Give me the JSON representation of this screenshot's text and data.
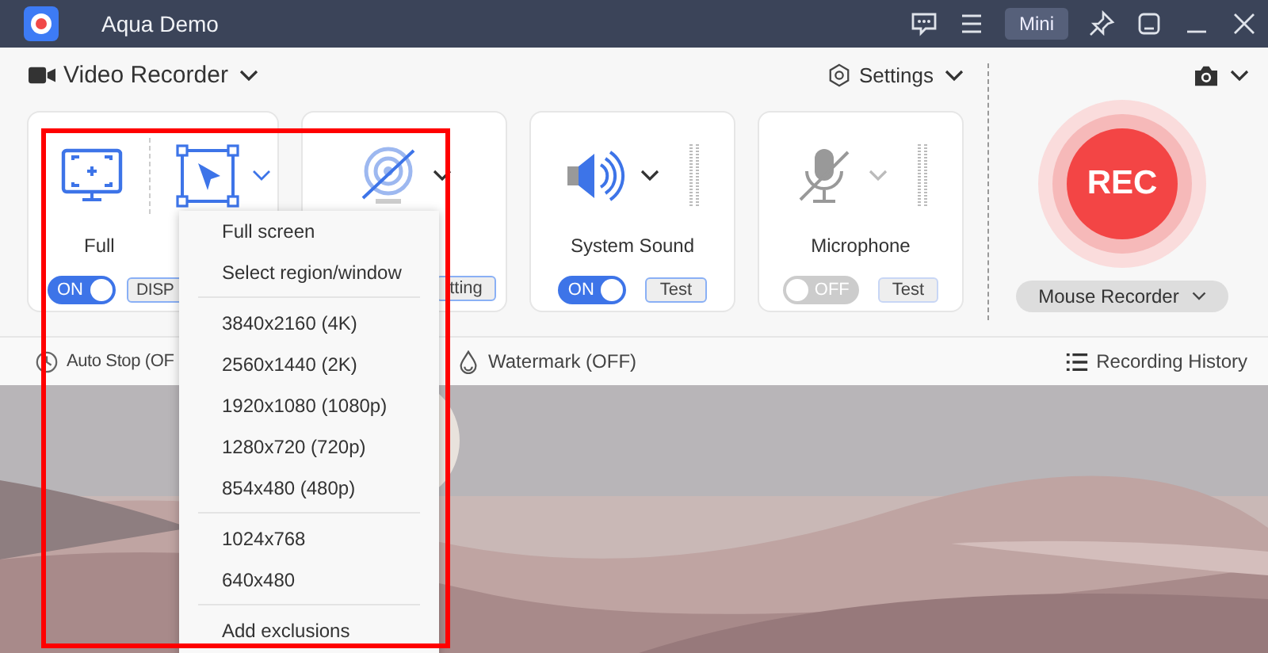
{
  "window": {
    "title": "Aqua Demo",
    "mini_button": "Mini"
  },
  "toolbar": {
    "mode": "Video Recorder",
    "settings": "Settings"
  },
  "cards": [
    {
      "kind": "display",
      "label": "Full",
      "toggle": {
        "label": "ON",
        "on": true
      },
      "button": "DISP"
    },
    {
      "kind": "webcam",
      "button": "tting"
    },
    {
      "kind": "sound",
      "label": "System Sound",
      "toggle": {
        "label": "ON",
        "on": true
      },
      "button": "Test"
    },
    {
      "kind": "mic",
      "label": "Microphone",
      "toggle": {
        "label": "OFF",
        "on": false
      },
      "button": "Test"
    }
  ],
  "record": {
    "button": "REC",
    "mode": "Mouse Recorder"
  },
  "bottom_bar": {
    "auto_stop": "Auto Stop (OF",
    "watermark": "Watermark (OFF)",
    "history": "Recording History"
  },
  "dropdown_menu": {
    "groups": [
      [
        "Full screen",
        "Select region/window"
      ],
      [
        "3840x2160 (4K)",
        "2560x1440 (2K)",
        "1920x1080 (1080p)",
        "1280x720 (720p)",
        "854x480 (480p)"
      ],
      [
        "1024x768",
        "640x480"
      ],
      [
        "Add exclusions"
      ]
    ]
  },
  "highlight": {
    "kind": "rectangle"
  }
}
